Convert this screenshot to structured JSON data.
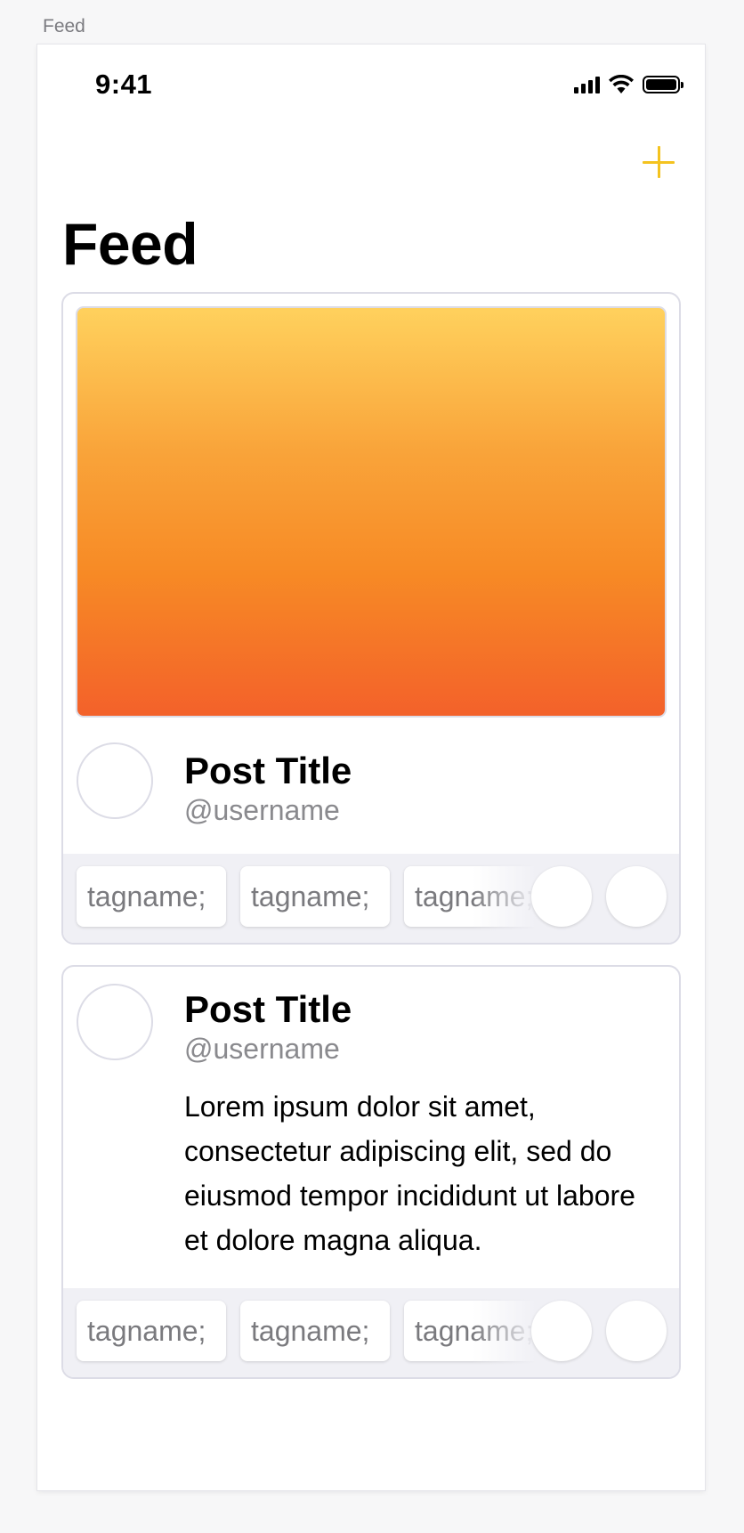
{
  "frame": {
    "label": "Feed"
  },
  "status_bar": {
    "time": "9:41",
    "icons": [
      "cellular-signal-icon",
      "wifi-icon",
      "battery-icon"
    ]
  },
  "nav": {
    "add_icon": "plus-icon",
    "accent_color": "#F4C31F"
  },
  "page": {
    "title": "Feed"
  },
  "posts": [
    {
      "has_image": true,
      "image_gradient": [
        "#FFD15D",
        "#F3612A"
      ],
      "title": "Post Title",
      "username": "@username",
      "body": "",
      "tags": [
        "tagname;",
        "tagname;",
        "tagname;"
      ]
    },
    {
      "has_image": false,
      "title": "Post Title",
      "username": "@username",
      "body": "Lorem ipsum dolor sit amet, consectetur adipiscing elit, sed do eiusmod tempor incididunt ut labore et dolore magna aliqua.",
      "tags": [
        "tagname;",
        "tagname;",
        "tagname;"
      ]
    }
  ]
}
